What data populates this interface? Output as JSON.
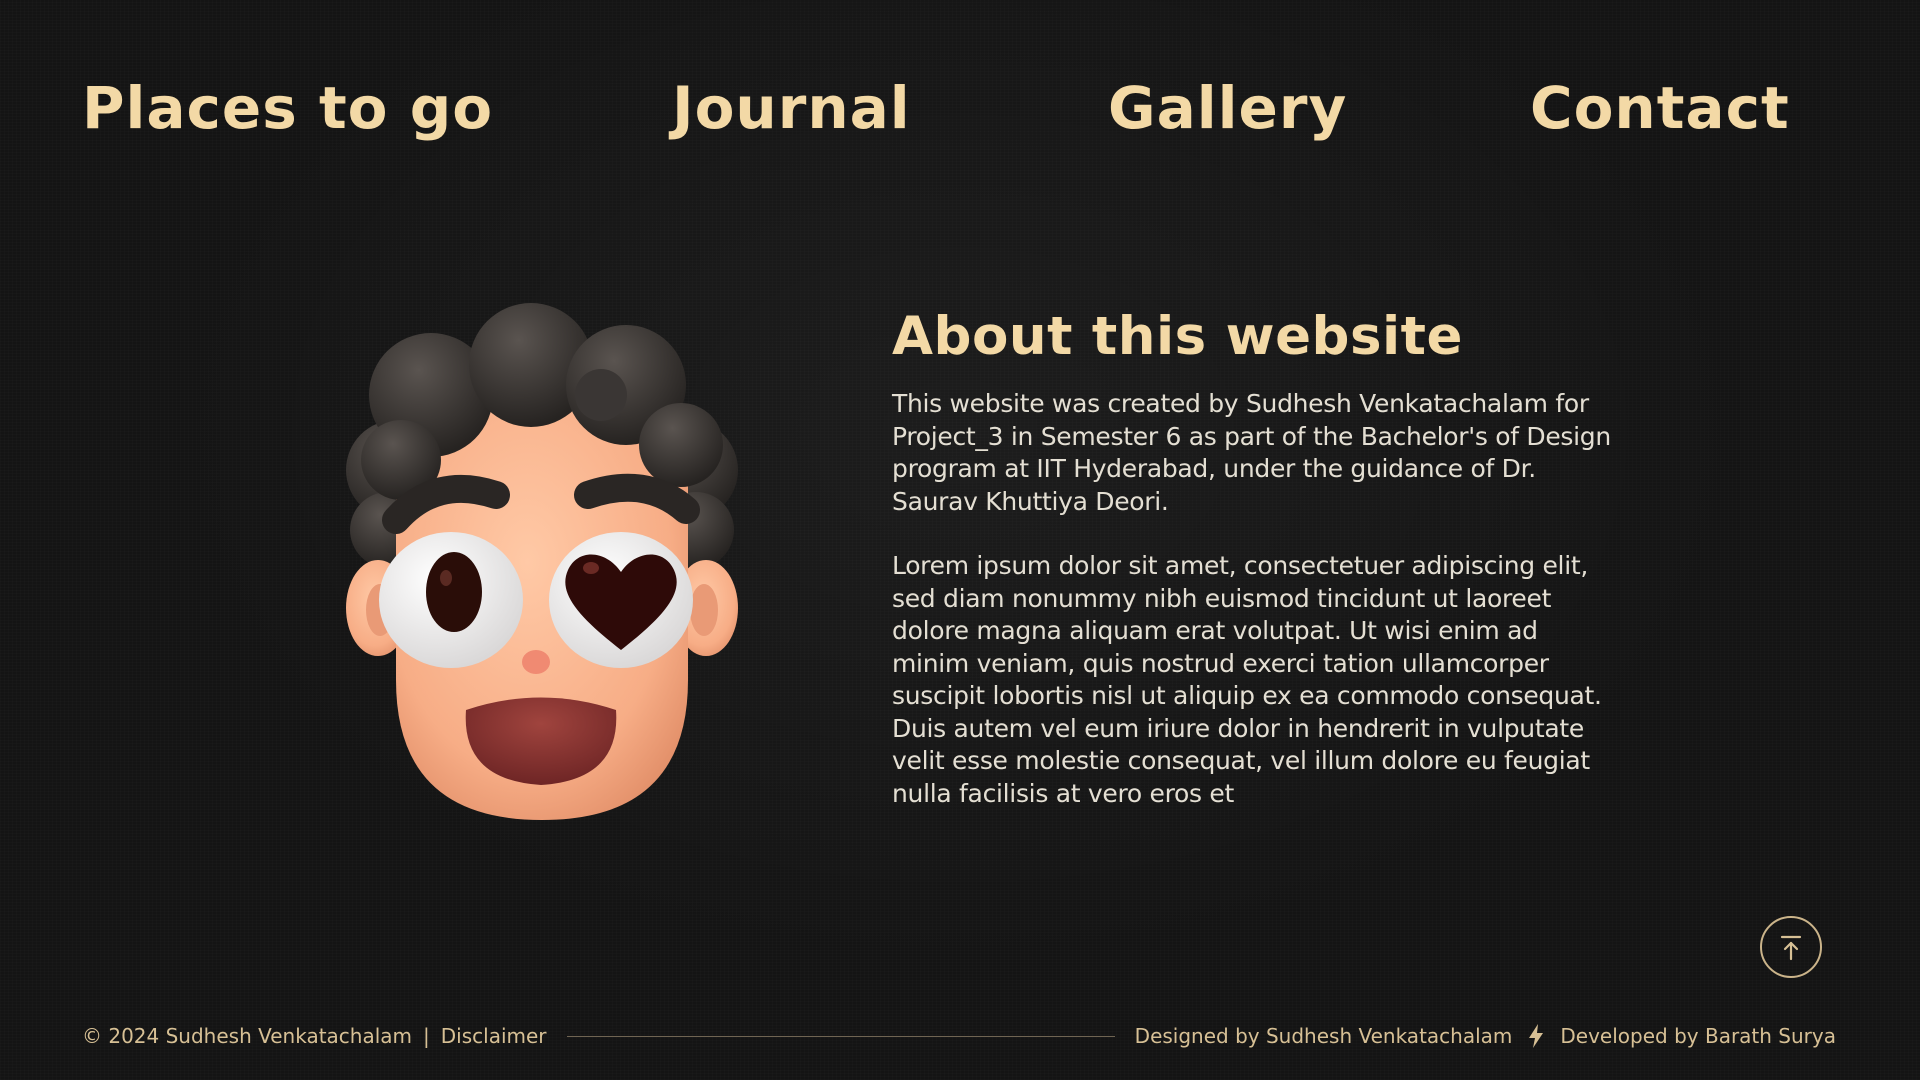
{
  "nav": {
    "items": [
      {
        "label": "Places to go"
      },
      {
        "label": "Journal"
      },
      {
        "label": "Gallery"
      },
      {
        "label": "Contact"
      }
    ]
  },
  "about": {
    "title": "About this website",
    "paragraph1": "This website was created by Sudhesh Venkatachalam for Project_3 in Semester 6 as part of the Bachelor's of Design program at IIT Hyderabad, under the guidance of Dr. Saurav Khuttiya Deori.",
    "paragraph2": "Lorem ipsum dolor sit amet, consectetuer adipiscing elit, sed diam nonummy nibh euismod tincidunt ut laoreet dolore magna aliquam erat volutpat. Ut wisi enim ad minim veniam, quis nostrud exerci tation ullamcorper suscipit lobortis nisl ut aliquip ex ea commodo consequat. Duis autem vel eum iriure dolor in hendrerit in vulputate velit esse molestie consequat, vel illum dolore eu feugiat nulla facilisis at vero eros et"
  },
  "avatar": {
    "icon": "heart-eyes-emoji-avatar"
  },
  "back_to_top": {
    "icon": "arrow-up-to-line-icon"
  },
  "footer": {
    "copyright": "© 2024 Sudhesh Venkatachalam",
    "separator": "|",
    "disclaimer": "Disclaimer",
    "designed_by": "Designed by Sudhesh Venkatachalam",
    "developed_by": "Developed by Barath Surya",
    "bolt_icon": "lightning-bolt-icon"
  },
  "colors": {
    "background": "#141414",
    "accent": "#f3d9a6",
    "body_text": "#e4dfd3",
    "footer_text": "#d7c095"
  }
}
